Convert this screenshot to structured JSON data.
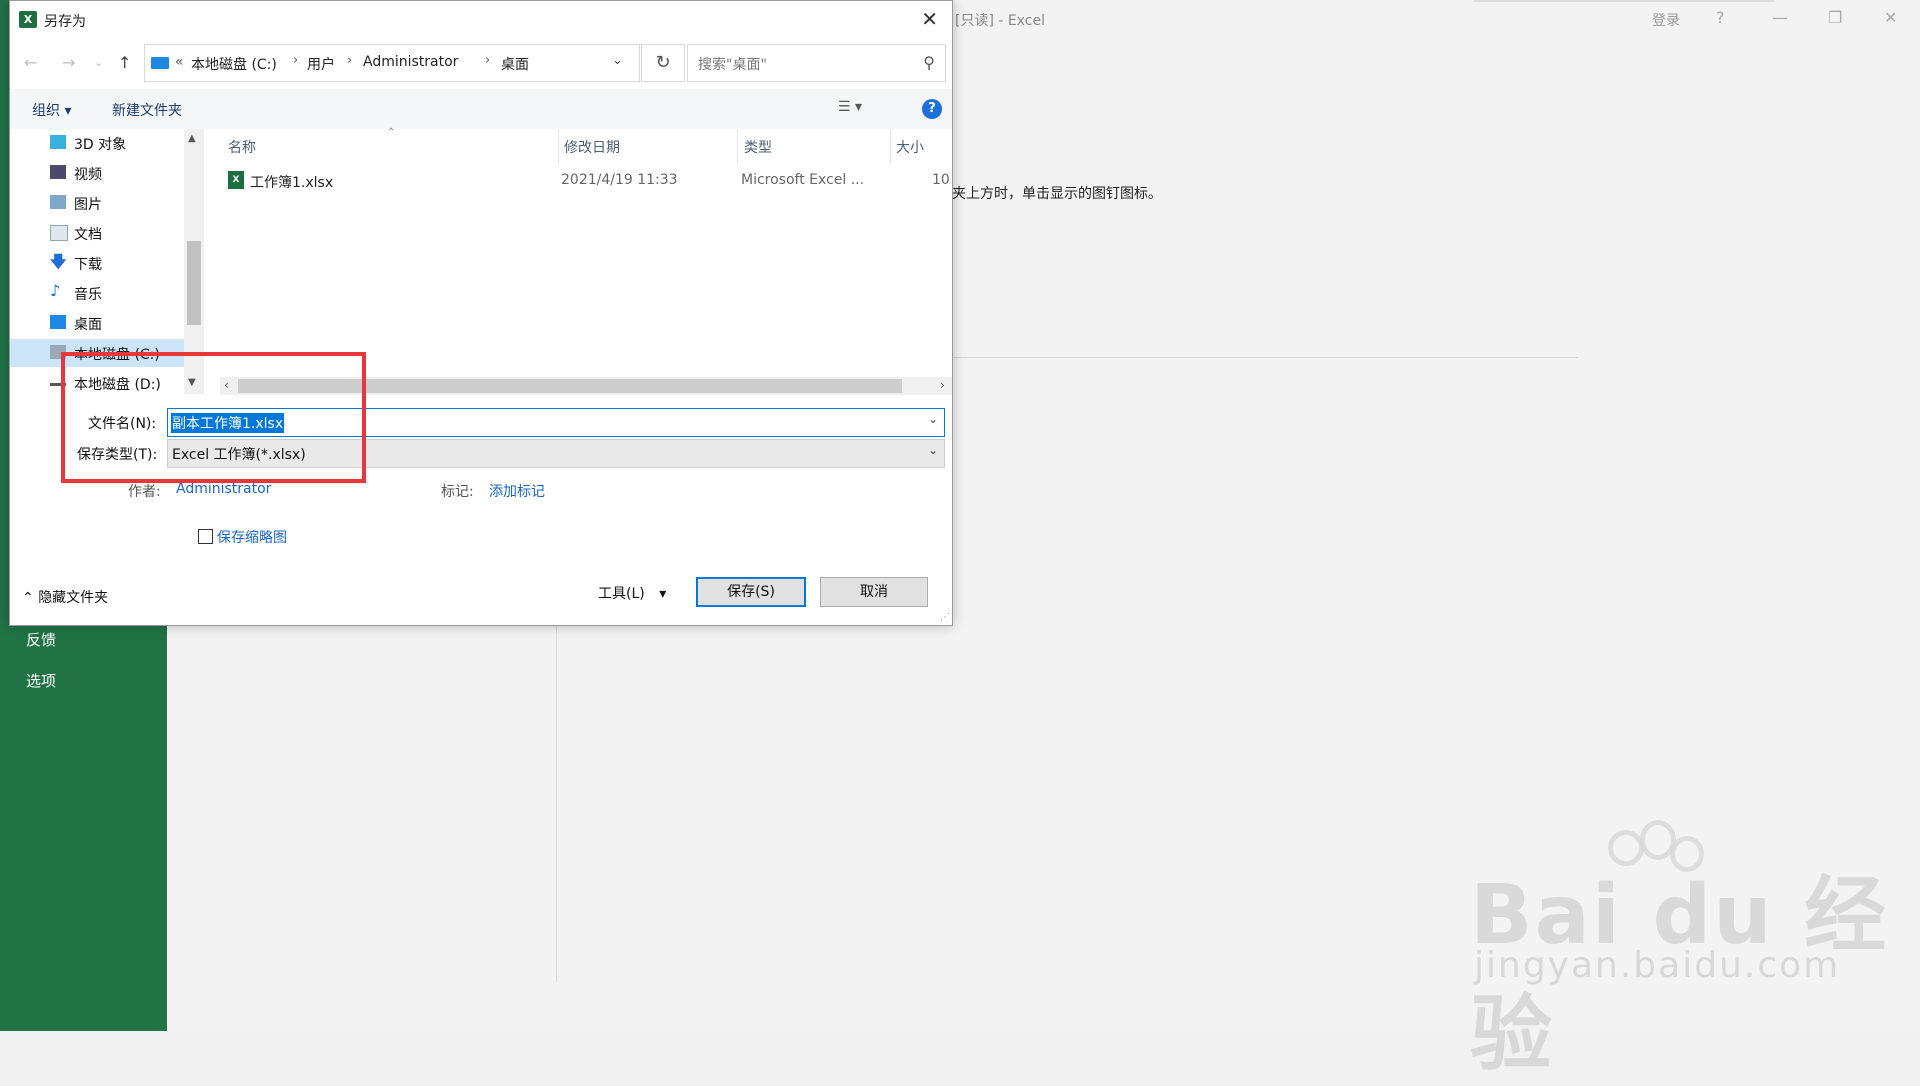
{
  "background": {
    "title": "[只读] - Excel",
    "login": "登录",
    "help": "?",
    "description": "夹上方时，单击显示的图钉图标。",
    "nav_items": [
      "反馈",
      "选项"
    ],
    "watermark_main": "Bai du 经验",
    "watermark_sub": "jingyan.baidu.com",
    "accent_color": "#217346"
  },
  "dialog": {
    "title": "另存为",
    "address": {
      "crumbs": [
        "«",
        "本地磁盘 (C:)",
        "用户",
        "Administrator",
        "桌面"
      ],
      "search_placeholder": "搜索\"桌面\""
    },
    "toolbar": {
      "organize": "组织 ▾",
      "new_folder": "新建文件夹"
    },
    "tree": [
      {
        "label": "3D 对象",
        "icon": "cube-icon"
      },
      {
        "label": "视频",
        "icon": "video-icon"
      },
      {
        "label": "图片",
        "icon": "picture-icon"
      },
      {
        "label": "文档",
        "icon": "document-icon"
      },
      {
        "label": "下载",
        "icon": "download-icon"
      },
      {
        "label": "音乐",
        "icon": "music-icon"
      },
      {
        "label": "桌面",
        "icon": "desktop-icon"
      },
      {
        "label": "本地磁盘 (C:)",
        "icon": "drive-icon"
      },
      {
        "label": "本地磁盘 (D:)",
        "icon": "drive-icon"
      }
    ],
    "columns": [
      "名称",
      "修改日期",
      "类型",
      "大小"
    ],
    "files": [
      {
        "name": "工作簿1.xlsx",
        "modified": "2021/4/19 11:33",
        "type": "Microsoft Excel ...",
        "size": "10"
      }
    ],
    "filename_label": "文件名(N):",
    "filename_value": "副本工作簿1.xlsx",
    "filetype_label": "保存类型(T):",
    "filetype_value": "Excel 工作簿(*.xlsx)",
    "author_label": "作者:",
    "author_value": "Administrator",
    "tags_label": "标记:",
    "tags_value": "添加标记",
    "thumbnail_label": "保存缩略图",
    "hide_folders": "隐藏文件夹",
    "tools": "工具(L)",
    "save": "保存(S)",
    "cancel": "取消",
    "highlight_color": "#e8373c"
  }
}
